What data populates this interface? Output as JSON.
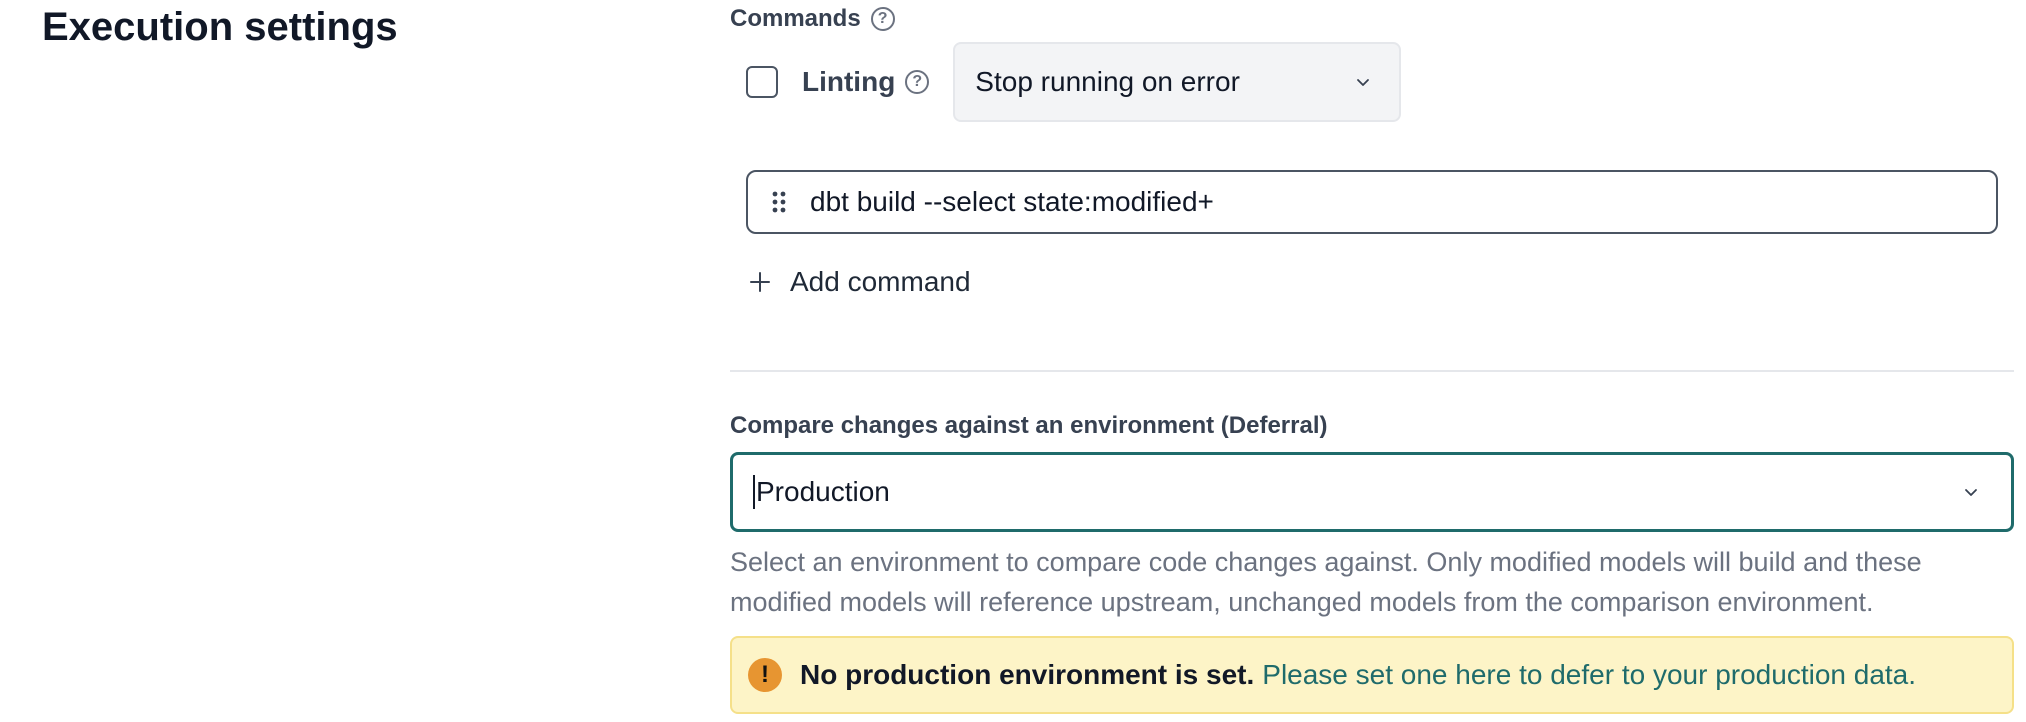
{
  "section": {
    "title": "Execution settings"
  },
  "commands": {
    "label": "Commands",
    "help_icon": "question-circle-icon",
    "linting": {
      "label": "Linting",
      "checked": false,
      "help_icon": "question-circle-icon",
      "on_error_option": "Stop running on error"
    },
    "items": [
      {
        "value": "dbt build --select state:modified+"
      }
    ],
    "add_command_label": "Add command"
  },
  "deferral": {
    "label": "Compare changes against an environment (Deferral)",
    "selected": "Production",
    "help_text": "Select an environment to compare code changes against. Only modified models will build and these modified models will reference upstream, unchanged models from the comparison environment.",
    "warning": {
      "icon": "exclamation-circle-icon",
      "strong": "No production environment is set.",
      "link": "Please set one here to defer to your production data."
    }
  },
  "colors": {
    "accent": "#1f6b6b",
    "warning_bg": "#fdf4c7",
    "warning_icon": "#e79531"
  }
}
